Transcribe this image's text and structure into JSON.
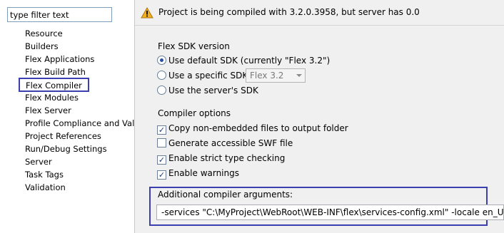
{
  "filter": {
    "placeholder": "type filter text"
  },
  "tree": {
    "items": [
      "Resource",
      "Builders",
      "Flex Applications",
      "Flex Build Path",
      "Flex Compiler",
      "Flex Modules",
      "Flex Server",
      "Profile Compliance and Valic",
      "Project References",
      "Run/Debug Settings",
      "Server",
      "Task Tags",
      "Validation"
    ],
    "selected": "Flex Compiler"
  },
  "warning": {
    "icon": "warning-icon",
    "text": "Project is being compiled with 3.2.0.3958, but server has 0.0"
  },
  "sdk": {
    "section_label": "Flex SDK version",
    "options": [
      {
        "label": "Use default SDK (currently \"Flex 3.2\")",
        "checked": true
      },
      {
        "label": "Use a specific SDK:",
        "checked": false
      },
      {
        "label": "Use the server's SDK",
        "checked": false
      }
    ],
    "select_value": "Flex 3.2"
  },
  "compiler": {
    "section_label": "Compiler options",
    "options": [
      {
        "label": "Copy non-embedded files to output folder",
        "checked": true
      },
      {
        "label": "Generate accessible SWF file",
        "checked": false
      },
      {
        "label": "Enable strict type checking",
        "checked": true
      },
      {
        "label": "Enable warnings",
        "checked": true
      }
    ]
  },
  "args": {
    "label": "Additional compiler arguments:",
    "value": "-services \"C:\\MyProject\\WebRoot\\WEB-INF\\flex\\services-config.xml\" -locale en_US"
  },
  "colors": {
    "highlight_border": "#3b3fb0",
    "warning_icon": "#e8a317"
  }
}
